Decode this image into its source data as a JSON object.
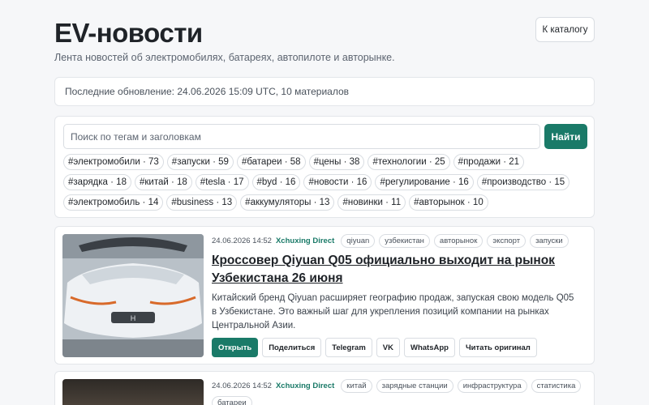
{
  "header": {
    "title": "EV-новости",
    "subtitle": "Лента новостей об электромобилях, батареях, автопилоте и авторынке.",
    "catalog_button": "К каталогу"
  },
  "status": {
    "text": "Последние обновление: 24.06.2026 15:09 UTC, 10 материалов"
  },
  "search": {
    "placeholder": "Поиск по тегам и заголовкам",
    "button": "Найти"
  },
  "tags": [
    "#электромобили · 73",
    "#запуски · 59",
    "#батареи · 58",
    "#цены · 38",
    "#технологии · 25",
    "#продажи · 21",
    "#зарядка · 18",
    "#китай · 18",
    "#tesla · 17",
    "#byd · 16",
    "#новости · 16",
    "#регулирование · 16",
    "#производство · 15",
    "#электромобиль · 14",
    "#business · 13",
    "#аккумуляторы · 13",
    "#новинки · 11",
    "#авторынок · 10"
  ],
  "articles": [
    {
      "date": "24.06.2026 14:52",
      "source": "Xchuxing Direct",
      "tags": [
        "qiyuan",
        "узбекистан",
        "авторынок",
        "экспорт",
        "запуски"
      ],
      "title": "Кроссовер Qiyuan Q05 официально выходит на рынок Узбекистана 26 июня",
      "description": "Китайский бренд Qiyuan расширяет географию продаж, запуская свою модель Q05 в Узбекистане. Это важный шаг для укрепления позиций компании на рынках Центральной Азии.",
      "actions": {
        "open": "Открыть",
        "share": "Поделиться",
        "telegram": "Telegram",
        "vk": "VK",
        "whatsapp": "WhatsApp",
        "read_original": "Читать оригинал"
      }
    },
    {
      "date": "24.06.2026 14:52",
      "source": "Xchuxing Direct",
      "tags": [
        "китай",
        "зарядные станции",
        "инфраструктура",
        "статистика",
        "батареи"
      ]
    }
  ],
  "colors": {
    "accent": "#1a7a68",
    "background": "#f6f7f9",
    "card": "#ffffff",
    "border": "#e3e6ea"
  }
}
